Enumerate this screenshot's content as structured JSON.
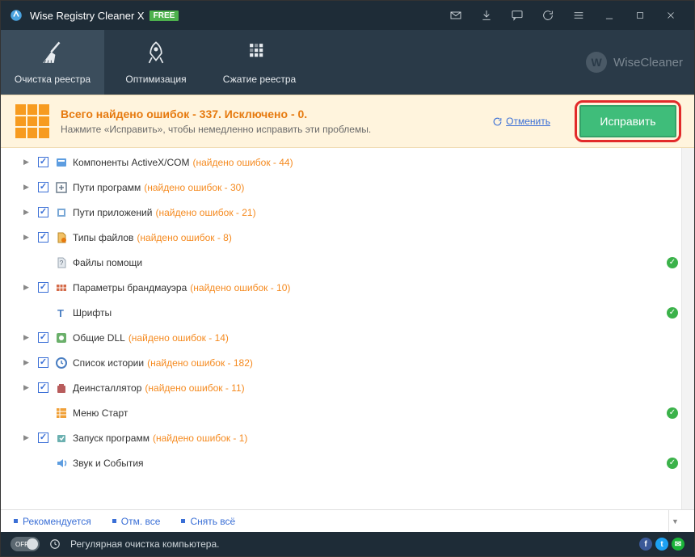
{
  "title": "Wise Registry Cleaner X",
  "free_badge": "FREE",
  "brand": "WiseCleaner",
  "tabs": [
    {
      "label": "Очистка реестра",
      "active": true
    },
    {
      "label": "Оптимизация",
      "active": false
    },
    {
      "label": "Сжатие реестра",
      "active": false
    }
  ],
  "summary": {
    "title": "Всего найдено ошибок - 337. Исключено - 0.",
    "subtitle": "Нажмите «Исправить», чтобы немедленно исправить эти проблемы.",
    "cancel": "Отменить",
    "fix": "Исправить"
  },
  "items": [
    {
      "label": "Компоненты ActiveX/COM",
      "errors": "(найдено ошибок - 44)",
      "checked": true,
      "chev": true,
      "ok": false,
      "icon": "activex"
    },
    {
      "label": "Пути программ",
      "errors": "(найдено ошибок - 30)",
      "checked": true,
      "chev": true,
      "ok": false,
      "icon": "paths"
    },
    {
      "label": "Пути приложений",
      "errors": "(найдено ошибок - 21)",
      "checked": true,
      "chev": true,
      "ok": false,
      "icon": "apppaths"
    },
    {
      "label": "Типы файлов",
      "errors": "(найдено ошибок - 8)",
      "checked": true,
      "chev": true,
      "ok": false,
      "icon": "filetype"
    },
    {
      "label": "Файлы помощи",
      "errors": "",
      "checked": false,
      "hidecb": true,
      "chev": false,
      "ok": true,
      "icon": "help"
    },
    {
      "label": "Параметры брандмауэра",
      "errors": "(найдено ошибок - 10)",
      "checked": true,
      "chev": true,
      "ok": false,
      "icon": "firewall"
    },
    {
      "label": "Шрифты",
      "errors": "",
      "checked": false,
      "hidecb": true,
      "chev": false,
      "ok": true,
      "icon": "font"
    },
    {
      "label": "Общие DLL",
      "errors": "(найдено ошибок - 14)",
      "checked": true,
      "chev": true,
      "ok": false,
      "icon": "dll"
    },
    {
      "label": "Список истории",
      "errors": "(найдено ошибок - 182)",
      "checked": true,
      "chev": true,
      "ok": false,
      "icon": "history"
    },
    {
      "label": "Деинсталлятор",
      "errors": "(найдено ошибок - 11)",
      "checked": true,
      "chev": true,
      "ok": false,
      "icon": "uninstall"
    },
    {
      "label": "Меню Старт",
      "errors": "",
      "checked": false,
      "hidecb": true,
      "chev": false,
      "ok": true,
      "icon": "startmenu"
    },
    {
      "label": "Запуск программ",
      "errors": "(найдено ошибок - 1)",
      "checked": true,
      "chev": true,
      "ok": false,
      "icon": "startup"
    },
    {
      "label": "Звук и События",
      "errors": "",
      "checked": false,
      "hidecb": true,
      "chev": false,
      "ok": true,
      "icon": "sound"
    }
  ],
  "links": [
    "Рекомендуется",
    "Отм. все",
    "Снять всё"
  ],
  "statusbar": {
    "toggle": "OFF",
    "text": "Регулярная очистка компьютера."
  }
}
